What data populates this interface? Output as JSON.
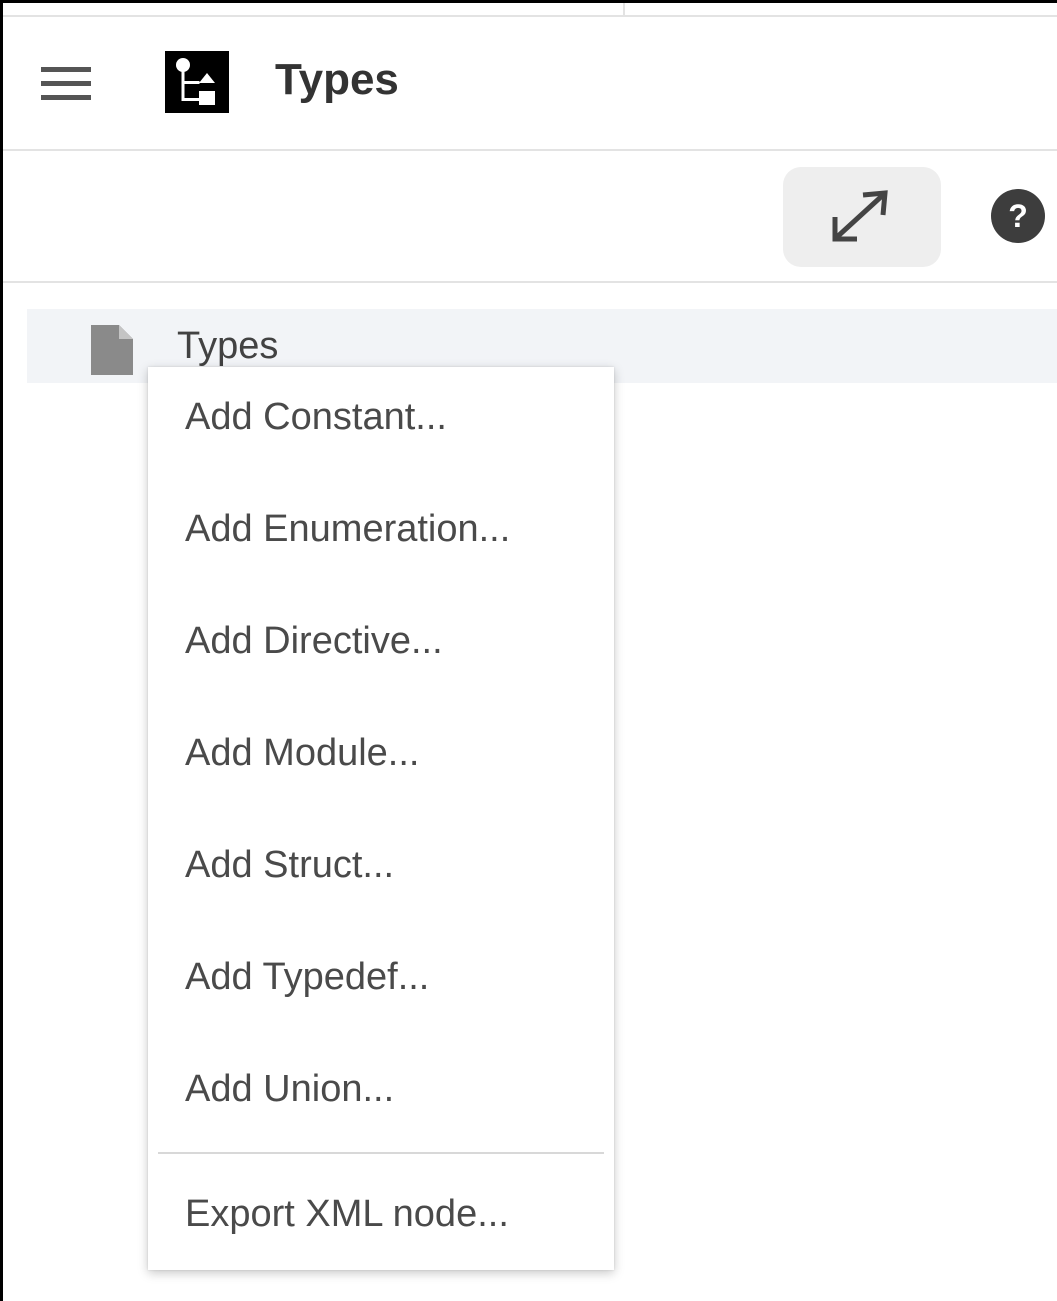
{
  "header": {
    "menu_icon": "hamburger-menu-icon",
    "app_icon": "type-tree-icon",
    "title": "Types"
  },
  "toolbar": {
    "expand_icon": "expand-arrows-icon",
    "help_icon": "help-icon",
    "help_glyph": "?"
  },
  "tree": {
    "item_icon": "document-icon",
    "item_label": "Types"
  },
  "context_menu": {
    "items": [
      {
        "label": "Add Constant..."
      },
      {
        "label": "Add Enumeration..."
      },
      {
        "label": "Add Directive..."
      },
      {
        "label": "Add Module..."
      },
      {
        "label": "Add Struct..."
      },
      {
        "label": "Add Typedef..."
      },
      {
        "label": "Add Union..."
      }
    ],
    "export_label": "Export XML node..."
  },
  "colors": {
    "selection_bg": "#f2f4f7",
    "button_bg": "#eeeeee",
    "text": "#424242",
    "icon": "#555555"
  }
}
